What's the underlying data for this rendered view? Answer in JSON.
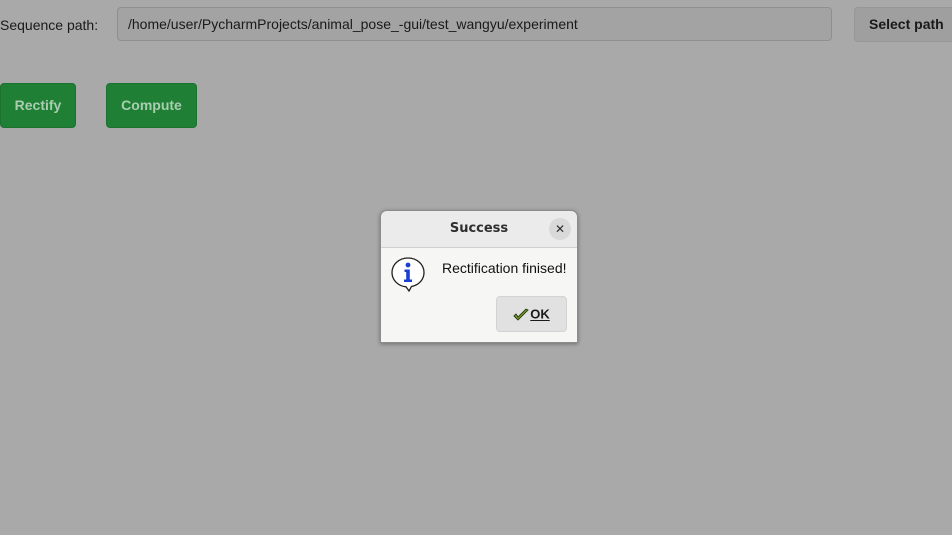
{
  "main": {
    "sequence_label": "Sequence path:",
    "path_value": "/home/user/PycharmProjects/animal_pose_-gui/test_wangyu/experiment",
    "select_path_label": "Select path",
    "rectify_label": "Rectify",
    "compute_label": "Compute"
  },
  "dialog": {
    "title": "Success",
    "close_glyph": "✕",
    "message": "Rectification finised!",
    "ok_label": "OK",
    "icon": "info-icon"
  },
  "colors": {
    "background": "#a9a9a9",
    "green_button": "#1f7f35",
    "dialog_bg": "#f6f6f5"
  }
}
